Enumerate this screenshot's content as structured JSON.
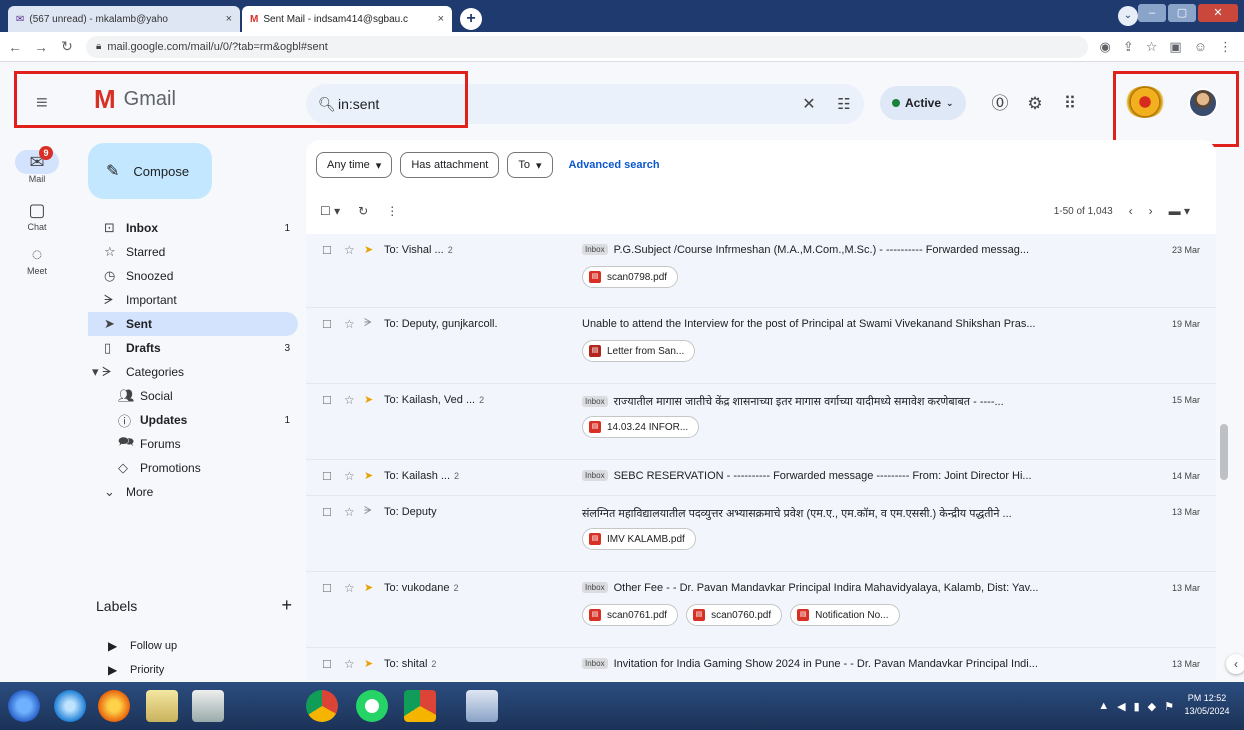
{
  "browser": {
    "tabs": [
      {
        "title": "(567 unread) - mkalamb@yaho",
        "close": "×"
      },
      {
        "title": "Sent Mail - indsam414@sgbau.c",
        "close": "×"
      }
    ],
    "new_tab": "+",
    "url": "mail.google.com/mail/u/0/?tab=rm&ogbl#sent"
  },
  "header": {
    "app_name": "Gmail",
    "search_value": "in:sent",
    "status_label": "Active"
  },
  "rail": [
    {
      "label": "Mail",
      "badge": "9"
    },
    {
      "label": "Chat"
    },
    {
      "label": "Meet"
    }
  ],
  "compose_label": "Compose",
  "nav": [
    {
      "label": "Inbox",
      "count": "1",
      "icon": "inbox-icon"
    },
    {
      "label": "Starred",
      "count": "",
      "icon": "star-icon"
    },
    {
      "label": "Snoozed",
      "count": "",
      "icon": "clock-icon"
    },
    {
      "label": "Important",
      "count": "",
      "icon": "important-icon"
    },
    {
      "label": "Sent",
      "count": "",
      "icon": "send-icon"
    },
    {
      "label": "Drafts",
      "count": "3",
      "icon": "draft-icon"
    },
    {
      "label": "Categories",
      "count": "",
      "icon": "category-icon"
    },
    {
      "label": "Social",
      "count": "",
      "icon": "people-icon"
    },
    {
      "label": "Updates",
      "count": "1",
      "icon": "info-icon"
    },
    {
      "label": "Forums",
      "count": "",
      "icon": "forum-icon"
    },
    {
      "label": "Promotions",
      "count": "",
      "icon": "tag-icon"
    },
    {
      "label": "More",
      "count": "",
      "icon": "chevron-down-icon"
    }
  ],
  "labels": {
    "heading": "Labels",
    "add": "+",
    "items": [
      "Follow up",
      "Priority"
    ]
  },
  "filters": {
    "chips": [
      "Any time",
      "Has attachment",
      "To"
    ],
    "advanced": "Advanced search"
  },
  "pager": "1-50 of 1,043",
  "emails": [
    {
      "to": "To: Vishal ...",
      "count": "2",
      "inbox": "Inbox",
      "subject": "P.G.Subject /Course Infrmeshan (M.A.,M.Com.,M.Sc.) - ---------- Forwarded messag...",
      "date": "23 Mar",
      "attachments": [
        "scan0798.pdf"
      ]
    },
    {
      "to": "To: Deputy, gunjkarcoll.",
      "count": "",
      "inbox": "",
      "subject": "Unable to attend the Interview for the post of Principal at Swami Vivekanand Shikshan Pras...",
      "date": "19 Mar",
      "attachments": [
        "Letter from San..."
      ]
    },
    {
      "to": "To: Kailash, Ved ...",
      "count": "2",
      "inbox": "Inbox",
      "subject": "राज्यातील मागास जातीचे केंद्र शासनाच्या इतर मागास वर्गाच्या यादीमध्ये समावेश करणेबाबत - ----...",
      "date": "15 Mar",
      "attachments": [
        "14.03.24 INFOR..."
      ]
    },
    {
      "to": "To: Kailash ...",
      "count": "2",
      "inbox": "Inbox",
      "subject": "SEBC RESERVATION - ---------- Forwarded message --------- From: Joint Director Hi...",
      "date": "14 Mar",
      "attachments": []
    },
    {
      "to": "To: Deputy",
      "count": "",
      "inbox": "",
      "subject": "संलग्नित महाविद्यालयातील पदव्युत्तर अभ्यासक्रमाचे प्रवेश (एम.ए., एम.कॉम, व एम.एससी.) केन्द्रीय पद्धतीने ...",
      "date": "13 Mar",
      "attachments": [
        "IMV KALAMB.pdf"
      ]
    },
    {
      "to": "To: vukodane",
      "count": "2",
      "inbox": "Inbox",
      "subject": "Other Fee - - Dr. Pavan Mandavkar Principal Indira Mahavidyalaya, Kalamb, Dist: Yav...",
      "date": "13 Mar",
      "attachments": [
        "scan0761.pdf",
        "scan0760.pdf",
        "Notification No..."
      ]
    },
    {
      "to": "To: shital",
      "count": "2",
      "inbox": "Inbox",
      "subject": "Invitation for India Gaming Show 2024 in Pune - - Dr. Pavan Mandavkar Principal Indi...",
      "date": "13 Mar",
      "attachments": []
    }
  ],
  "taskbar": {
    "time": "PM 12:52",
    "date": "13/05/2024"
  }
}
